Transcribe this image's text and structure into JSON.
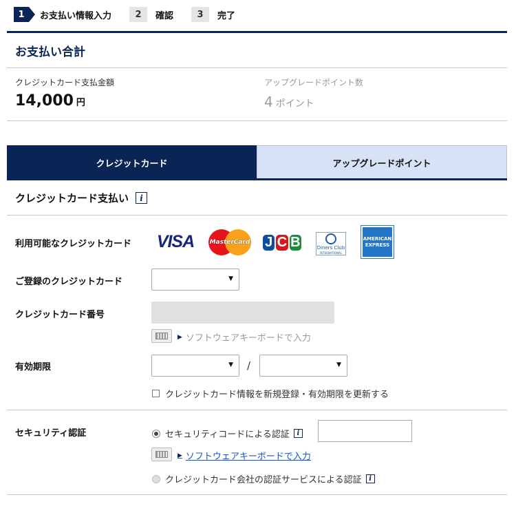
{
  "steps": [
    {
      "num": "1",
      "label": "お支払い情報入力",
      "active": true
    },
    {
      "num": "2",
      "label": "確認",
      "active": false
    },
    {
      "num": "3",
      "label": "完了",
      "active": false
    }
  ],
  "summary": {
    "title": "お支払い合計",
    "cc_amount_label": "クレジットカード支払金額",
    "cc_amount_value": "14,000",
    "cc_amount_unit": "円",
    "points_label": "アップグレードポイント数",
    "points_value": "4",
    "points_unit": "ポイント"
  },
  "tabs": {
    "credit_card": "クレジットカード",
    "upgrade_points": "アップグレードポイント"
  },
  "form": {
    "section_title": "クレジットカード支払い",
    "available_cards_label": "利用可能なクレジットカード",
    "cards": {
      "visa": "VISA",
      "mastercard": "MasterCard",
      "jcb": [
        "J",
        "C",
        "B"
      ],
      "diners": "Diners Club",
      "diners_sub": "INTERNATIONAL",
      "amex": "AMERICAN EXPRESS"
    },
    "registered_card_label": "ご登録のクレジットカード",
    "card_number_label": "クレジットカード番号",
    "software_keyboard_link": "ソフトウェアキーボードで入力",
    "expiry_label": "有効期限",
    "expiry_separator": "/",
    "update_checkbox_label": "クレジットカード情報を新規登録・有効期限を更新する"
  },
  "security": {
    "label": "セキュリティ認証",
    "option_code": "セキュリティコードによる認証",
    "software_keyboard_link": "ソフトウェアキーボードで入力",
    "option_service": "クレジットカード会社の認証サービスによる認証"
  },
  "icons": {
    "info": "i",
    "dropdown_arrow": "▼",
    "link_triangle": "▶"
  },
  "colors": {
    "navy": "#0a2455",
    "tab_inactive": "#d7e2f7",
    "link_blue": "#1155cc"
  }
}
